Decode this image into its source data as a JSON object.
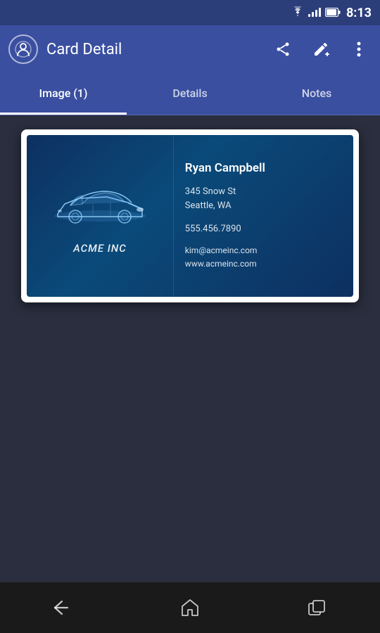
{
  "statusBar": {
    "time": "8:13",
    "wifiIcon": "wifi",
    "signalIcon": "signal",
    "batteryIcon": "battery"
  },
  "appBar": {
    "title": "Card Detail",
    "logoIcon": "contact-card-icon",
    "shareIcon": "share-icon",
    "editIcon": "edit-plus-icon",
    "moreIcon": "more-vert-icon"
  },
  "tabs": [
    {
      "id": "image",
      "label": "Image (1)",
      "active": true
    },
    {
      "id": "details",
      "label": "Details",
      "active": false
    },
    {
      "id": "notes",
      "label": "Notes",
      "active": false
    }
  ],
  "businessCard": {
    "companyName": "Acme Inc",
    "contactName": "Ryan Campbell",
    "address": "345 Snow St\nSeattle, WA",
    "addressLine1": "345 Snow St",
    "addressLine2": "Seattle, WA",
    "phone": "555.456.7890",
    "email": "kim@acmeinc.com",
    "website": "www.acmeinc.com"
  },
  "bottomNav": {
    "backIcon": "back-icon",
    "homeIcon": "home-icon",
    "recentIcon": "recent-apps-icon"
  }
}
